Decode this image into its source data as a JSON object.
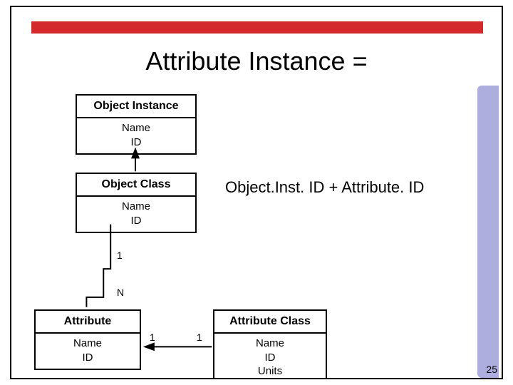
{
  "title": "Attribute Instance =",
  "formula": "Object.Inst. ID + Attribute. ID",
  "boxes": {
    "object_instance": {
      "title": "Object Instance",
      "lines": [
        "Name",
        "ID"
      ]
    },
    "object_class": {
      "title": "Object Class",
      "lines": [
        "Name",
        "ID"
      ]
    },
    "attribute": {
      "title": "Attribute",
      "lines": [
        "Name",
        "ID"
      ]
    },
    "attribute_class": {
      "title": "Attribute Class",
      "lines": [
        "Name",
        "ID",
        "Units"
      ]
    }
  },
  "cardinalities": {
    "one_a": "1",
    "n": "N",
    "one_b": "1",
    "one_c": "1"
  },
  "page_number": "25"
}
